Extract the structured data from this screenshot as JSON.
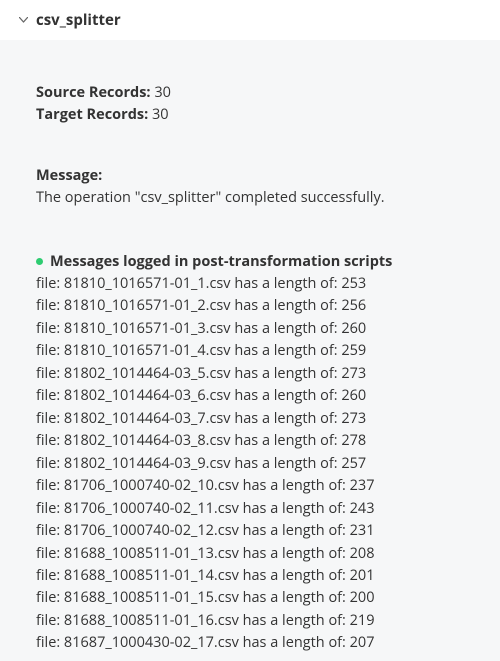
{
  "header": {
    "title": "csv_splitter"
  },
  "records": {
    "source_label": "Source Records:",
    "source_value": "30",
    "target_label": "Target Records:",
    "target_value": "30"
  },
  "message": {
    "label": "Message:",
    "text": "The operation \"csv_splitter\" completed successfully."
  },
  "logs": {
    "header": "Messages logged in post-transformation scripts",
    "lines": [
      "file: 81810_1016571-01_1.csv has a length of: 253",
      "file: 81810_1016571-01_2.csv has a length of: 256",
      "file: 81810_1016571-01_3.csv has a length of: 260",
      "file: 81810_1016571-01_4.csv has a length of: 259",
      "file: 81802_1014464-03_5.csv has a length of: 273",
      "file: 81802_1014464-03_6.csv has a length of: 260",
      "file: 81802_1014464-03_7.csv has a length of: 273",
      "file: 81802_1014464-03_8.csv has a length of: 278",
      "file: 81802_1014464-03_9.csv has a length of: 257",
      "file: 81706_1000740-02_10.csv has a length of: 237",
      "file: 81706_1000740-02_11.csv has a length of: 243",
      "file: 81706_1000740-02_12.csv has a length of: 231",
      "file: 81688_1008511-01_13.csv has a length of: 208",
      "file: 81688_1008511-01_14.csv has a length of: 201",
      "file: 81688_1008511-01_15.csv has a length of: 200",
      "file: 81688_1008511-01_16.csv has a length of: 219",
      "file: 81687_1000430-02_17.csv has a length of: 207"
    ]
  }
}
